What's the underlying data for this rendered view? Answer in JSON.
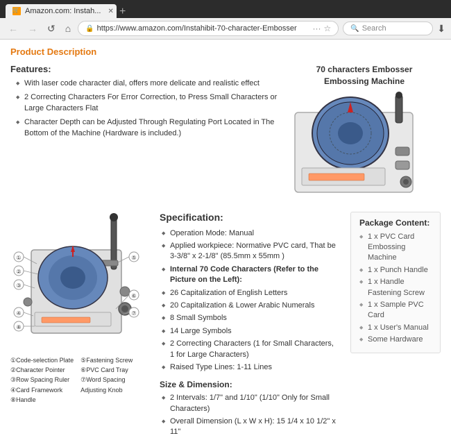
{
  "browser": {
    "tab_label": "Amazon.com: Instah...",
    "url": "https://www.amazon.com/Instahibit-70-character-Embosser",
    "search_placeholder": "Search",
    "new_tab_label": "+"
  },
  "nav": {
    "back_label": "←",
    "forward_label": "→",
    "refresh_label": "↺",
    "home_label": "⌂",
    "more_label": "···",
    "star_label": "☆",
    "download_label": "⬇"
  },
  "page": {
    "section_title": "Product Description",
    "product_title_right": "70 characters Embosser\nEmbossing Machine",
    "features_heading": "Features:",
    "features": [
      "With laser code character dial, offers more delicate and realistic effect",
      "2 Correcting Characters For Error Correction, to Press Small Characters or Large Characters Flat",
      "Character Depth can be Adjusted Through Regulating Port Located in The Bottom of the Machine (Hardware is included.)"
    ],
    "spec_heading": "Specification:",
    "specs": [
      {
        "text": "Operation Mode: Manual",
        "bold": false
      },
      {
        "text": "Applied workpiece: Normative PVC card, That be 3-3/8\" x 2-1/8\" (85.5mm x 55mm )",
        "bold": false
      },
      {
        "text": "Internal 70 Code Characters (Refer to the Picture on the Left):",
        "bold": true
      },
      {
        "text": "26 Capitalization of English Letters",
        "bold": false
      },
      {
        "text": "20 Capitalization & Lower Arabic Numerals",
        "bold": false
      },
      {
        "text": "8 Small Symbols",
        "bold": false
      },
      {
        "text": "14 Large Symbols",
        "bold": false
      },
      {
        "text": "2 Correcting Characters (1 for Small Characters, 1 for Large Characters)",
        "bold": false
      },
      {
        "text": "Raised Type Lines: 1-11 Lines",
        "bold": false
      }
    ],
    "size_heading": "Size & Dimension:",
    "size_specs": [
      "2 Intervals: 1/7\" and 1/10\" (1/10\" Only for Small Characters)",
      "Overall Dimension (L x W x H): 15 1/4 x 10 1/2\" x 11\""
    ],
    "package_title": "Package Content:",
    "package_items": [
      "1 x PVC Card Embossing Machine",
      "1 x Punch Handle",
      "1 x Handle Fastening Screw",
      "1 x Sample PVC Card",
      "1 x User's Manual",
      "Some Hardware"
    ],
    "diagram_labels": [
      "①Code-selection Plate",
      "②Character Pointer",
      "③Row Spacing Ruler",
      "④Card Framework Handle",
      "",
      "⑤Fastening Screw",
      "⑥PVC Card Tray",
      "⑦Word Spacing Adjusting Knob"
    ]
  }
}
